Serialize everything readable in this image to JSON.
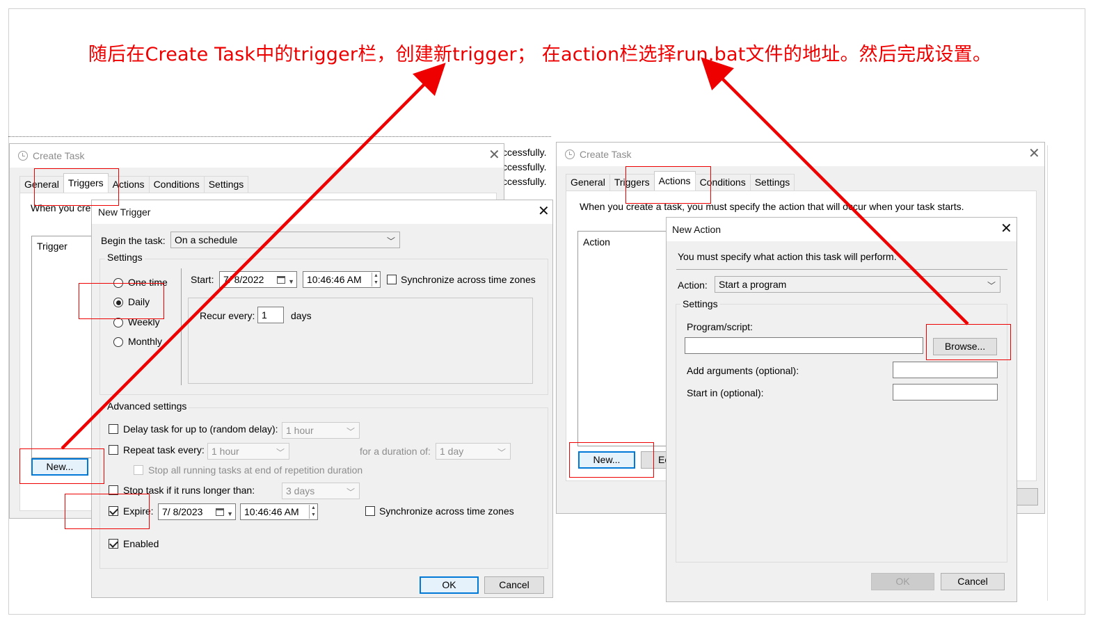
{
  "caption": "随后在Create Task中的trigger栏，创建新trigger； 在action栏选择run.bat文件的地址。然后完成设置。",
  "background_text": {
    "lines": [
      "ccessfully.",
      "ccessfully.",
      "ccessfully."
    ]
  },
  "left_create_task": {
    "title": "Create Task",
    "tabs": [
      "General",
      "Triggers",
      "Actions",
      "Conditions",
      "Settings"
    ],
    "active_tab": "Triggers",
    "intro_text": "When you crea",
    "list_header": "Trigger",
    "new_button": "New..."
  },
  "new_trigger": {
    "title": "New Trigger",
    "begin_label": "Begin the task:",
    "begin_value": "On a schedule",
    "settings_label": "Settings",
    "schedule_options": [
      "One time",
      "Daily",
      "Weekly",
      "Monthly"
    ],
    "selected_schedule": "Daily",
    "start_label": "Start:",
    "start_date": "7/  8/2022",
    "start_time": "10:46:46 AM",
    "sync_label": "Synchronize across time zones",
    "recur_label": "Recur every:",
    "recur_value": "1",
    "recur_unit": "days",
    "advanced_label": "Advanced settings",
    "delay_label": "Delay task for up to (random delay):",
    "delay_value": "1 hour",
    "repeat_label": "Repeat task every:",
    "repeat_value": "1 hour",
    "duration_label": "for a duration of:",
    "duration_value": "1 day",
    "stop_running_label": "Stop all running tasks at end of repetition duration",
    "stop_longer_label": "Stop task if it runs longer than:",
    "stop_longer_value": "3 days",
    "expire_label": "Expire:",
    "expire_date": "7/  8/2023",
    "expire_time": "10:46:46 AM",
    "expire_sync_label": "Synchronize across time zones",
    "enabled_label": "Enabled",
    "ok_button": "OK",
    "cancel_button": "Cancel"
  },
  "right_create_task": {
    "title": "Create Task",
    "tabs": [
      "General",
      "Triggers",
      "Actions",
      "Conditions",
      "Settings"
    ],
    "active_tab": "Actions",
    "intro_text": "When you create a task, you must specify the action that will occur when your task starts.",
    "list_header": "Action",
    "new_button": "New...",
    "edit_button_partial": "Ec"
  },
  "new_action": {
    "title": "New Action",
    "intro_text": "You must specify what action this task will perform.",
    "action_label": "Action:",
    "action_value": "Start a program",
    "settings_label": "Settings",
    "program_label": "Program/script:",
    "program_value": "",
    "browse_button": "Browse...",
    "arguments_label": "Add arguments (optional):",
    "arguments_value": "",
    "start_in_label": "Start in (optional):",
    "start_in_value": "",
    "ok_button": "OK",
    "cancel_button": "Cancel"
  },
  "colors": {
    "annotation": "#ee0000",
    "dialog_bg": "#f0f0f0",
    "focus_blue": "#0078d7"
  }
}
